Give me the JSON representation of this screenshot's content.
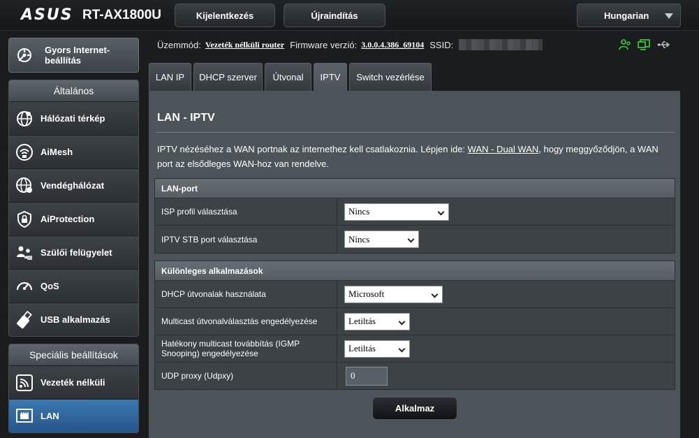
{
  "header": {
    "brand": "ASUS",
    "model": "RT-AX1800U",
    "logout_label": "Kijelentkezés",
    "reboot_label": "Újraindítás",
    "language": "Hungarian"
  },
  "sidebar": {
    "quick_setup": "Gyors Internet-beállítás",
    "general": {
      "title": "Általános",
      "items": [
        {
          "label": "Hálózati térkép",
          "icon": "network-map-icon"
        },
        {
          "label": "AiMesh",
          "icon": "aimesh-icon"
        },
        {
          "label": "Vendéghálózat",
          "icon": "guest-network-icon"
        },
        {
          "label": "AiProtection",
          "icon": "shield-lock-icon"
        },
        {
          "label": "Szülői felügyelet",
          "icon": "parental-control-icon"
        },
        {
          "label": "QoS",
          "icon": "speedometer-icon"
        },
        {
          "label": "USB alkalmazás",
          "icon": "usb-icon"
        }
      ]
    },
    "advanced": {
      "title": "Speciális beállítások",
      "items": [
        {
          "label": "Vezeték nélküli",
          "icon": "wireless-icon"
        },
        {
          "label": "LAN",
          "icon": "lan-icon",
          "active": true
        }
      ]
    }
  },
  "status": {
    "mode_label": "Üzemmód:",
    "mode_value": "Vezeték nélküli router",
    "firmware_label": "Firmware verzió:",
    "firmware_value": "3.0.0.4.386_69104",
    "ssid_label": "SSID:"
  },
  "tabs": [
    {
      "label": "LAN IP"
    },
    {
      "label": "DHCP szerver"
    },
    {
      "label": "Útvonal"
    },
    {
      "label": "IPTV",
      "active": true
    },
    {
      "label": "Switch vezérlése"
    }
  ],
  "page": {
    "title": "LAN - IPTV",
    "desc_before": "IPTV nézéséhez a WAN portnak az internethez kell csatlakoznia. Lépjen ide: ",
    "desc_link": "WAN - Dual WAN",
    "desc_after": ", hogy meggyőződjön, a WAN port az elsődleges WAN-hoz van rendelve."
  },
  "lan_port": {
    "title": "LAN-port",
    "rows": [
      {
        "label": "ISP profil választása",
        "value": "Nincs"
      },
      {
        "label": "IPTV STB port választása",
        "value": "Nincs"
      }
    ]
  },
  "special_apps": {
    "title": "Különleges alkalmazások",
    "rows": [
      {
        "label": "DHCP útvonalak használata",
        "value": "Microsoft"
      },
      {
        "label": "Multicast útvonalválasztás engedélyezése",
        "value": "Letiltás"
      },
      {
        "label": "Hatékony multicast továbbítás (IGMP Snooping) engedélyezése",
        "value": "Letiltás"
      },
      {
        "label": "UDP proxy (Udpxy)",
        "value": "0"
      }
    ]
  },
  "apply_label": "Alkalmaz",
  "colors": {
    "active_nav": "#3b78b0",
    "status_icon_green": "#3fd23f"
  }
}
